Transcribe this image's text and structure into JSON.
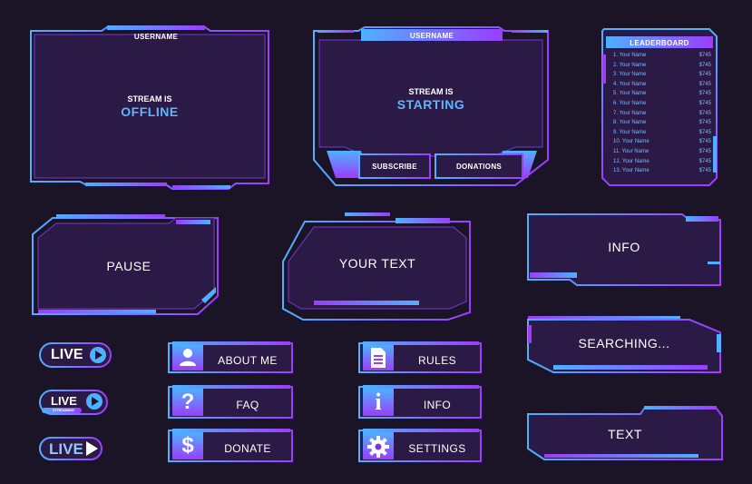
{
  "frames": {
    "offline": {
      "username": "USERNAME",
      "line1": "STREAM IS",
      "line2": "OFFLINE"
    },
    "starting": {
      "username": "USERNAME",
      "line1": "STREAM IS",
      "line2": "STARTING",
      "subscribe": "SUBSCRIBE",
      "donations": "DONATIONS"
    },
    "leaderboard": {
      "title": "LEADERBOARD",
      "rows": [
        {
          "name": "1. Your Name",
          "value": "$745"
        },
        {
          "name": "2. Your Name",
          "value": "$745"
        },
        {
          "name": "3. Your Name",
          "value": "$745"
        },
        {
          "name": "4. Your Name",
          "value": "$745"
        },
        {
          "name": "5. Your Name",
          "value": "$745"
        },
        {
          "name": "6. Your Name",
          "value": "$745"
        },
        {
          "name": "7. Your Name",
          "value": "$745"
        },
        {
          "name": "8. Your Name",
          "value": "$745"
        },
        {
          "name": "9. Your Name",
          "value": "$745"
        },
        {
          "name": "10. Your Name",
          "value": "$745"
        },
        {
          "name": "11. Your Name",
          "value": "$745"
        },
        {
          "name": "12. Your Name",
          "value": "$745"
        },
        {
          "name": "13. Your Name",
          "value": "$745"
        }
      ]
    },
    "pause": "PAUSE",
    "your_text": "YOUR TEXT",
    "info": "INFO",
    "searching": "SEARCHING...",
    "text": "TEXT"
  },
  "live_badges": {
    "live1": "LIVE",
    "live2": "LIVE",
    "live2_sub": "STREAMING",
    "live3": "LIVE"
  },
  "buttons": {
    "about_me": "ABOUT ME",
    "faq": "FAQ",
    "donate": "DONATE",
    "rules": "RULES",
    "info": "INFO",
    "settings": "SETTINGS"
  },
  "colors": {
    "background": "#1b1326",
    "panel": "#2a1a45",
    "accent_blue": "#4fb0ff",
    "accent_purple": "#9b3dff"
  }
}
